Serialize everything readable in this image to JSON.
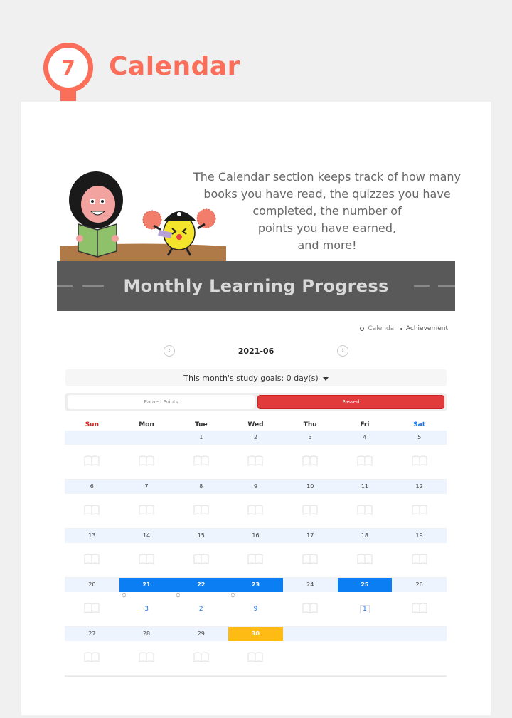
{
  "header": {
    "step_number": "7",
    "title": "Calendar"
  },
  "intro": {
    "lines": [
      "The Calendar section keeps track of how many",
      "books you have read, the quizzes you have",
      "completed, the number of",
      "points you have earned,",
      "and more!"
    ]
  },
  "banner": {
    "title": "Monthly Learning Progress"
  },
  "breadcrumb": {
    "calendar": "Calendar",
    "achievement": "Achievement"
  },
  "month_nav": {
    "label": "2021-06",
    "prev": "‹",
    "next": "›"
  },
  "goal": {
    "text": "This month's study goals: 0 day(s)"
  },
  "toggle": {
    "earned_points": "Earned Points",
    "passed": "Passed"
  },
  "weekdays": [
    "Sun",
    "Mon",
    "Tue",
    "Wed",
    "Thu",
    "Fri",
    "Sat"
  ],
  "weeks": [
    {
      "dates": [
        "",
        "",
        "1",
        "2",
        "3",
        "4",
        "5"
      ],
      "counts": [
        "",
        "",
        "",
        "",
        "",
        "",
        ""
      ]
    },
    {
      "dates": [
        "6",
        "7",
        "8",
        "9",
        "10",
        "11",
        "12"
      ],
      "counts": [
        "",
        "",
        "",
        "",
        "",
        "",
        ""
      ]
    },
    {
      "dates": [
        "13",
        "14",
        "15",
        "16",
        "17",
        "18",
        "19"
      ],
      "counts": [
        "",
        "",
        "",
        "",
        "",
        "",
        ""
      ]
    },
    {
      "dates": [
        "20",
        "21",
        "22",
        "23",
        "24",
        "25",
        "26"
      ],
      "counts": [
        "",
        "3",
        "2",
        "9",
        "",
        "1",
        ""
      ]
    },
    {
      "dates": [
        "27",
        "28",
        "29",
        "30",
        "",
        "",
        ""
      ],
      "counts": [
        "",
        "",
        "",
        "",
        "",
        "",
        ""
      ]
    }
  ],
  "colors": {
    "accent": "#fa6e5a",
    "banner": "#595959",
    "passed": "#e23b3b",
    "highlight_blue": "#0a7ef2",
    "today_yellow": "#fdbb13",
    "date_row": "#eef4fd"
  }
}
